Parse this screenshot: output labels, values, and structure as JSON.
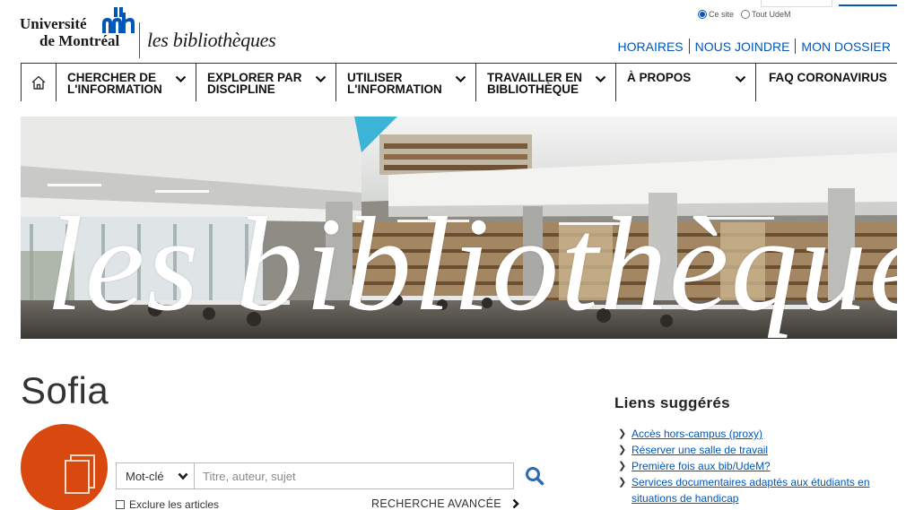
{
  "header": {
    "logo": {
      "university_line1": "Université",
      "university_line2": "de Montréal",
      "bibliotheques": "les bibliothèques"
    },
    "search_scope": {
      "options": [
        {
          "label": "Ce site",
          "selected": true
        },
        {
          "label": "Tout UdeM",
          "selected": false
        }
      ]
    },
    "utility_links": [
      "HORAIRES",
      "NOUS JOINDRE",
      "MON DOSSIER"
    ]
  },
  "nav": {
    "home_icon": "home-icon",
    "items": [
      {
        "line1": "CHERCHER DE",
        "line2": "L'INFORMATION",
        "has_dropdown": true
      },
      {
        "line1": "EXPLORER PAR",
        "line2": "DISCIPLINE",
        "has_dropdown": true
      },
      {
        "line1": "UTILISER",
        "line2": "L'INFORMATION",
        "has_dropdown": true
      },
      {
        "line1": "TRAVAILLER EN",
        "line2": "BIBLIOTHÈQUE",
        "has_dropdown": true
      },
      {
        "line1": "À PROPOS",
        "line2": "",
        "has_dropdown": true
      },
      {
        "line1": "FAQ CORONAVIRUS",
        "line2": "",
        "has_dropdown": false
      }
    ]
  },
  "hero": {
    "title": "les bibliothèques"
  },
  "sofia": {
    "title": "Sofia",
    "search_type": "Mot-clé",
    "search_placeholder": "Titre, auteur, sujet",
    "exclude_label": "Exclure les articles",
    "exclude_checked": false,
    "advanced_label": "RECHERCHE AVANCÉE"
  },
  "liens": {
    "title": "Liens suggérés",
    "items": [
      "Accès hors-campus (proxy)",
      "Réserver une salle de travail",
      "Première fois aux bib/UdeM?",
      "Services documentaires adaptés aux étudiants en situations de handicap"
    ]
  },
  "colors": {
    "link_blue": "#0057b8",
    "sofia_orange": "#d9480f",
    "brand_blue": "#0057b8"
  }
}
